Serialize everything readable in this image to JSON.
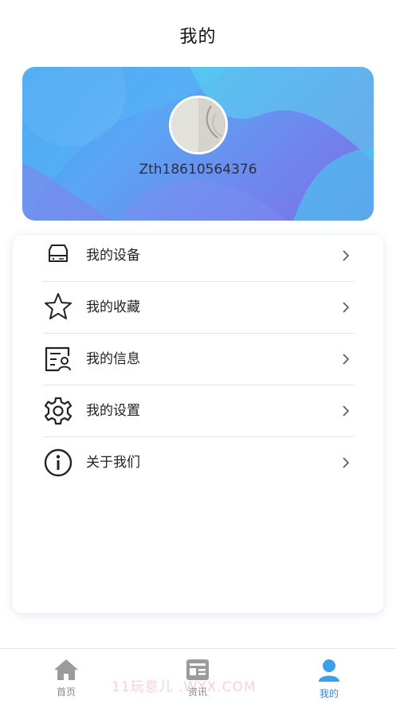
{
  "header": {
    "title": "我的"
  },
  "profile": {
    "username": "Zth18610564376"
  },
  "menu": {
    "items": [
      {
        "label": "我的设备",
        "icon": "device-icon"
      },
      {
        "label": "我的收藏",
        "icon": "star-icon"
      },
      {
        "label": "我的信息",
        "icon": "profile-info-icon"
      },
      {
        "label": "我的设置",
        "icon": "gear-icon"
      },
      {
        "label": "关于我们",
        "icon": "info-icon"
      }
    ]
  },
  "tabbar": {
    "tabs": [
      {
        "label": "首页",
        "icon": "home-icon",
        "active": false
      },
      {
        "label": "资讯",
        "icon": "news-icon",
        "active": false
      },
      {
        "label": "我的",
        "icon": "user-icon",
        "active": true
      }
    ]
  },
  "watermark": "11玩意儿 .WYX.COM",
  "colors": {
    "accent": "#3b82d6",
    "inactive": "#888888",
    "hero_start": "#3f9cf0",
    "hero_end": "#7c6ee6"
  }
}
